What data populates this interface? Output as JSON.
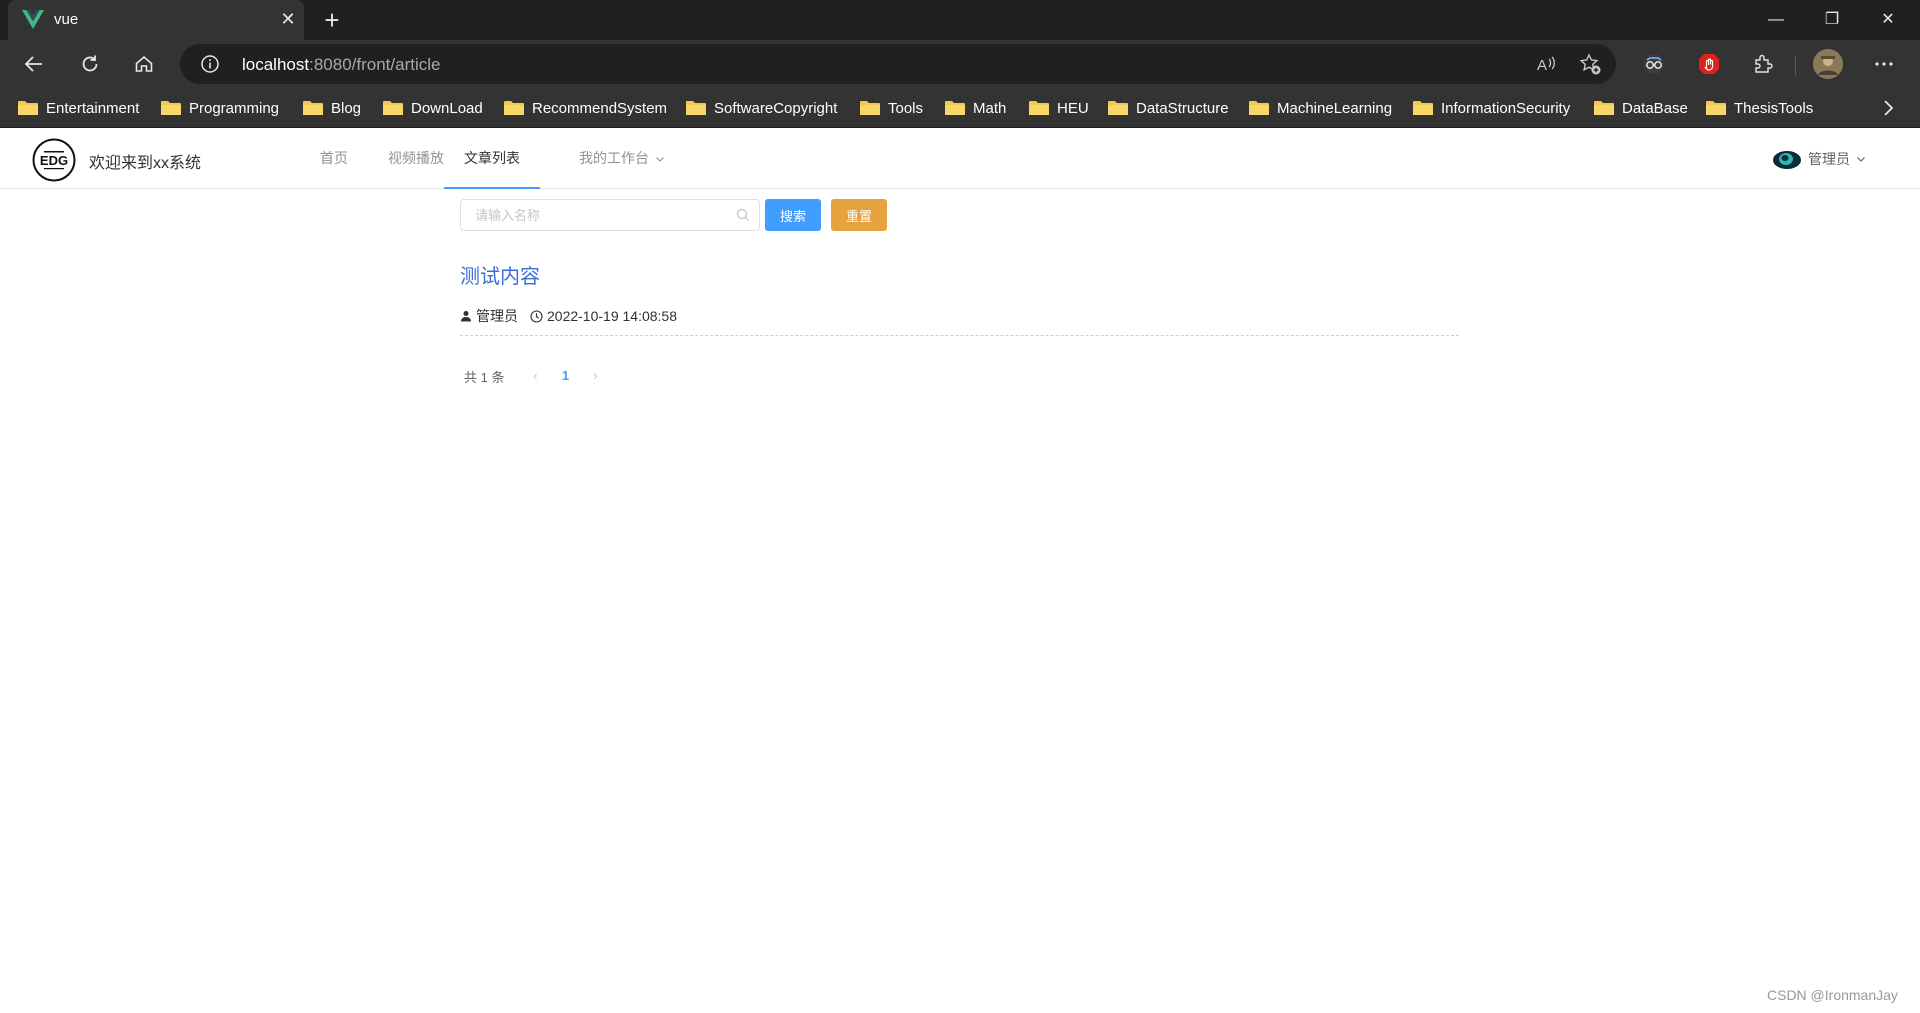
{
  "browser": {
    "tab_title": "vue",
    "tab_close": "✕",
    "new_tab": "+",
    "url_host": "localhost",
    "url_path": ":8080/front/article",
    "window": {
      "minimize": "—",
      "restore": "❐",
      "close": "✕"
    }
  },
  "bookmarks": [
    {
      "label": "Entertainment"
    },
    {
      "label": "Programming"
    },
    {
      "label": "Blog"
    },
    {
      "label": "DownLoad"
    },
    {
      "label": "RecommendSystem"
    },
    {
      "label": "SoftwareCopyright"
    },
    {
      "label": "Tools"
    },
    {
      "label": "Math"
    },
    {
      "label": "HEU"
    },
    {
      "label": "DataStructure"
    },
    {
      "label": "MachineLearning"
    },
    {
      "label": "InformationSecurity"
    },
    {
      "label": "DataBase"
    },
    {
      "label": "ThesisTools"
    }
  ],
  "site": {
    "logo_text": "EDG",
    "title": "欢迎来到xx系统",
    "menu": [
      {
        "label": "首页"
      },
      {
        "label": "视频播放"
      },
      {
        "label": "文章列表"
      },
      {
        "label": "我的工作台"
      }
    ],
    "user_name": "管理员"
  },
  "search": {
    "placeholder": "请输入名称",
    "search_label": "搜索",
    "reset_label": "重置"
  },
  "articles": [
    {
      "title": "测试内容",
      "author": "管理员",
      "time": "2022-10-19 14:08:58"
    }
  ],
  "pagination": {
    "total_text": "共 1 条",
    "prev": "‹",
    "current": "1",
    "next": "›"
  },
  "watermark": "CSDN @IronmanJay",
  "colors": {
    "primary": "#409eff",
    "warning": "#e6a23c",
    "article_title": "#3b6fd6",
    "browser_dark": "#202020",
    "browser_toolbar": "#333333"
  }
}
